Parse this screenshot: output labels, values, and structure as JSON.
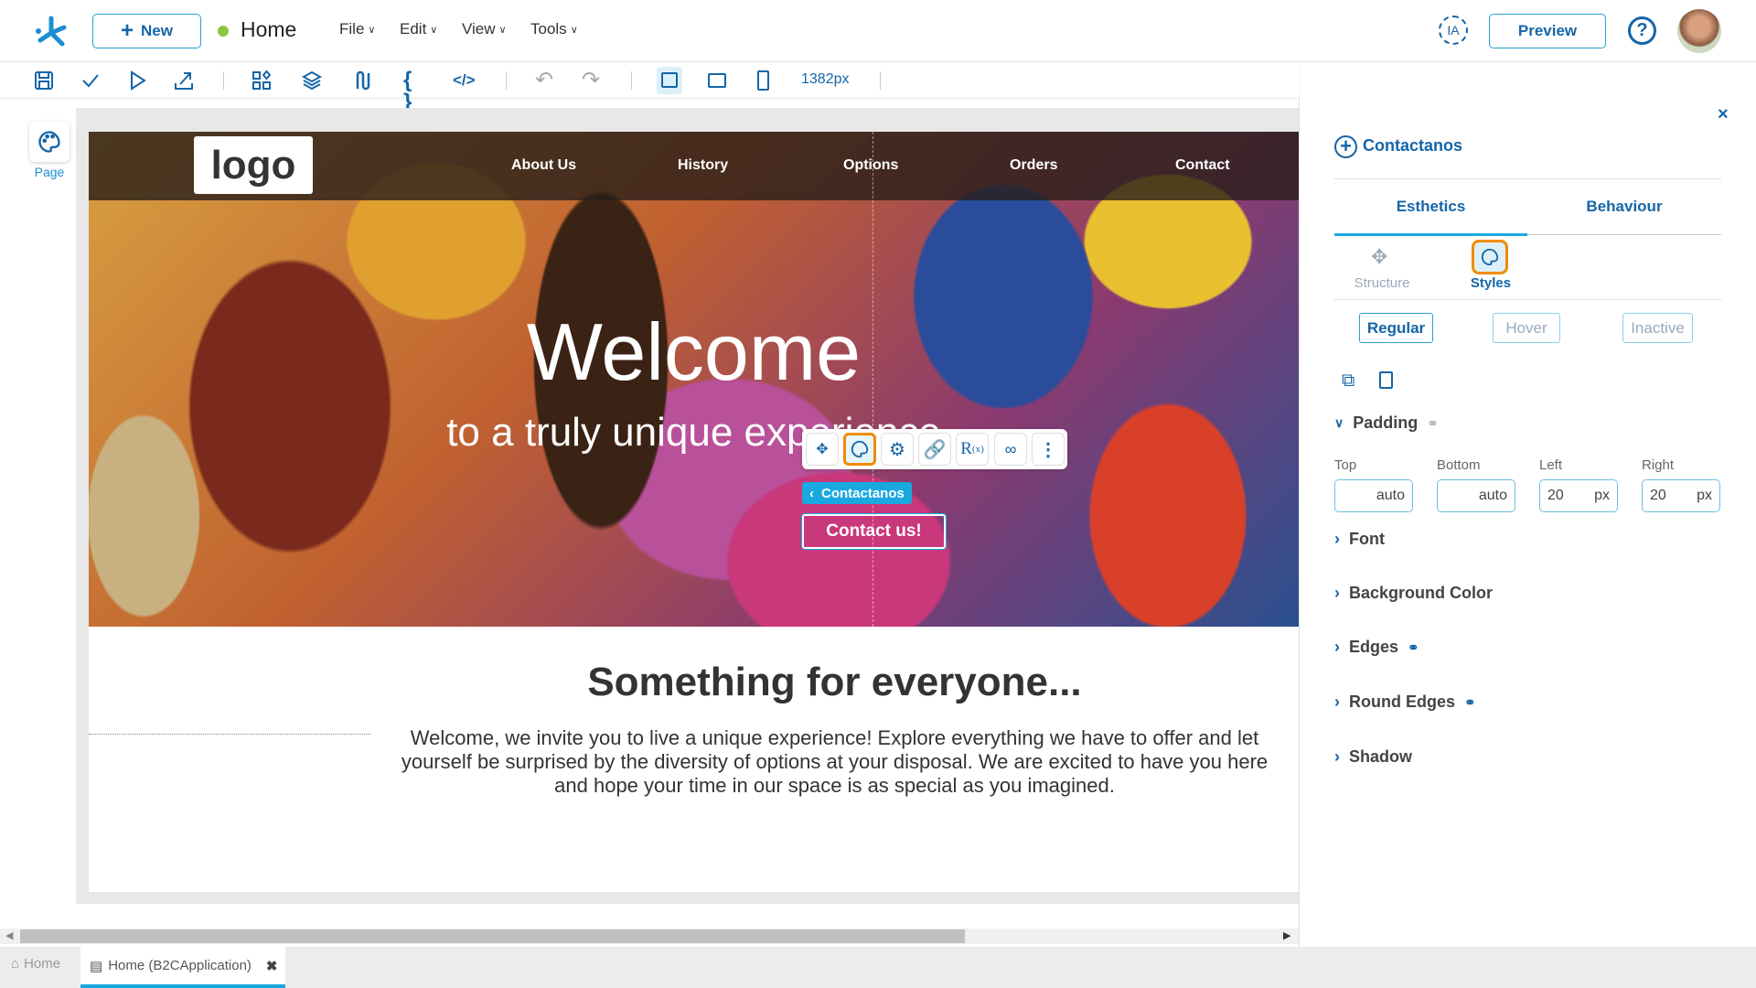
{
  "topbar": {
    "new_label": "New",
    "page_title": "Home",
    "status_color": "#8dc63f",
    "menus": [
      "File",
      "Edit",
      "View",
      "Tools"
    ],
    "ia_label": "IA",
    "preview_label": "Preview"
  },
  "toolbar": {
    "width_readout": "1382px",
    "icons": [
      "save-icon",
      "check-icon",
      "play-icon",
      "export-icon",
      "components-icon",
      "layers-icon",
      "flow-icon",
      "braces-icon",
      "code-icon",
      "undo-icon",
      "redo-icon",
      "desktop-icon",
      "tablet-icon",
      "mobile-icon"
    ]
  },
  "rail": {
    "page_label": "Page"
  },
  "site": {
    "logo": "logo",
    "nav": [
      "About Us",
      "History",
      "Options",
      "Orders",
      "Contact"
    ],
    "hero_title": "Welcome",
    "hero_subtitle": "to a truly unique experience",
    "button_label": "Contact us!",
    "card_title": "Something for everyone...",
    "card_lines": [
      "Welcome, we invite you to live a unique experience! Explore everything we have to offer and let",
      "yourself be surprised by the diversity of options at your disposal. We are excited to have you here",
      "and hope your time in our space is as special as you imagined."
    ]
  },
  "selection": {
    "tag": "Contactanos",
    "accent": "#19a8e0",
    "highlight": "#f08c00"
  },
  "panel": {
    "title": "Contactanos",
    "tabs": [
      "Esthetics",
      "Behaviour"
    ],
    "subtabs": [
      "Structure",
      "Styles"
    ],
    "states": [
      "Regular",
      "Hover",
      "Inactive"
    ],
    "padding": {
      "label": "Padding",
      "fields": [
        {
          "label": "Top",
          "value": "auto",
          "unit": ""
        },
        {
          "label": "Bottom",
          "value": "auto",
          "unit": ""
        },
        {
          "label": "Left",
          "value": "20",
          "unit": "px"
        },
        {
          "label": "Right",
          "value": "20",
          "unit": "px"
        }
      ]
    },
    "sections": [
      "Font",
      "Background Color",
      "Edges",
      "Round Edges",
      "Shadow"
    ]
  },
  "bottom": {
    "home_tab": "Home",
    "active_tab": "Home (B2CApplication)"
  }
}
